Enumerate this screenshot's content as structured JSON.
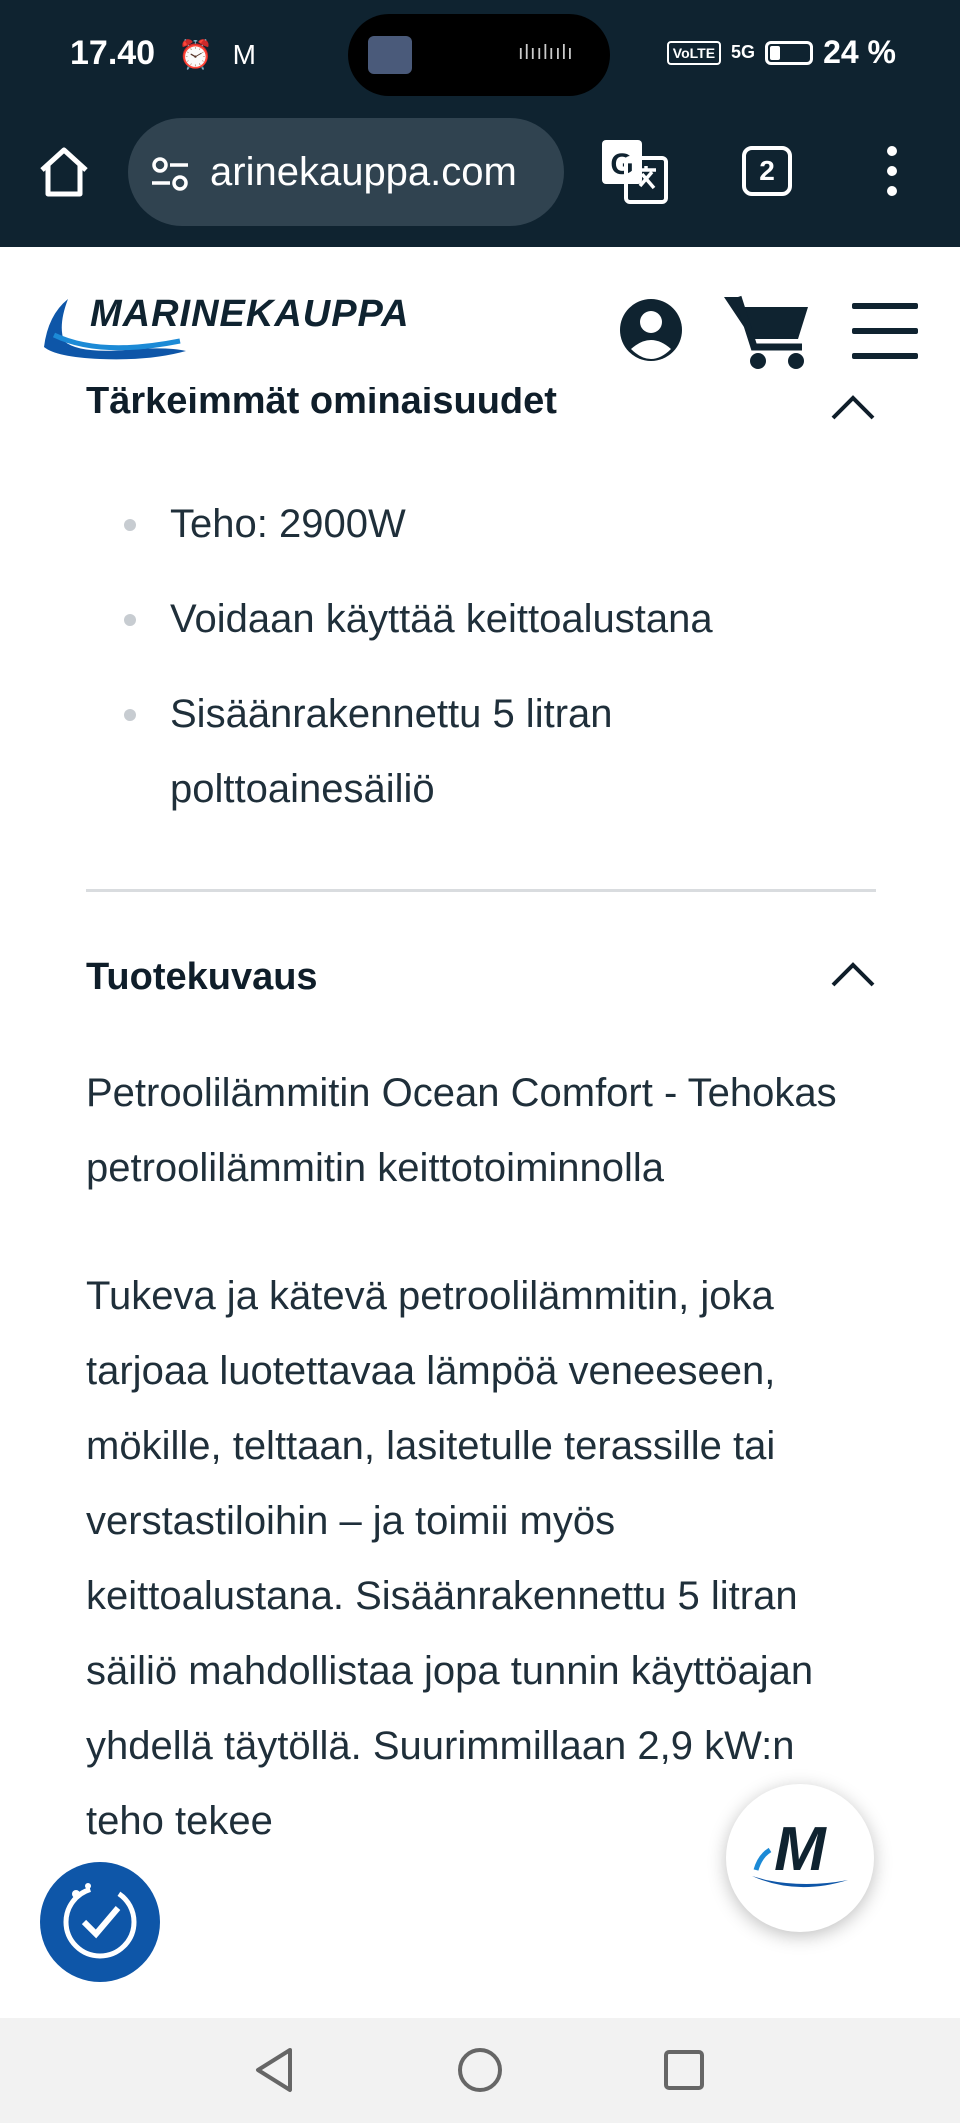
{
  "status_bar": {
    "time": "17.40",
    "status_icons": "⏰ M",
    "volte": "VoLTE",
    "network": "5G",
    "battery": "24 %"
  },
  "browser": {
    "url": "arinekauppa.com",
    "tab_count": "2"
  },
  "site": {
    "brand": "MARINEKAUPPA"
  },
  "features": {
    "title": "Tärkeimmät ominaisuudet",
    "items": [
      "Teho: 2900W",
      "Voidaan käyttää keittoalustana",
      "Sisäänrakennettu 5 litran polttoainesäiliö"
    ]
  },
  "description": {
    "title": "Tuotekuvaus",
    "heading": "Petroolilämmitin Ocean Comfort - Tehokas petroolilämmitin keittotoiminnolla",
    "body": "Tukeva ja kätevä petroolilämmitin, joka tarjoaa luotettavaa lämpöä veneeseen, mökille, telttaan, lasitetulle terassille tai verstastiloihin – ja toimii myös keittoalustana. Sisäänrakennettu 5 litran säiliö mahdollistaa jopa tunnin käyttöajan yhdellä täytöllä. Suurimmillaan 2,9 kW:n teho tekee"
  },
  "floating": {
    "chat_logo_letter": "M"
  },
  "colors": {
    "dark_header": "#0f2330",
    "brand_blue": "#0e56a8"
  }
}
